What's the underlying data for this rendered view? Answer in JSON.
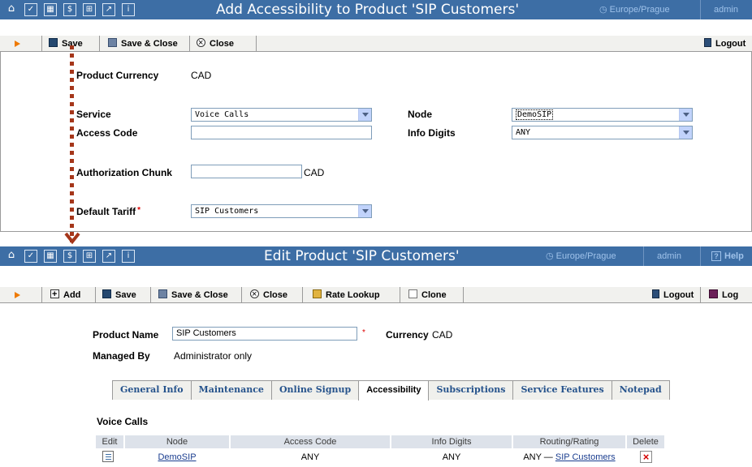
{
  "top_window": {
    "nav_icons": [
      "home-icon",
      "checklist-icon",
      "grid-icon",
      "dollar-icon",
      "tree-icon",
      "chart-icon",
      "info-icon"
    ],
    "title": "Add Accessibility to Product 'SIP Customers'",
    "timezone": "Europe/Prague",
    "user": "admin",
    "toolbar": {
      "save": "Save",
      "save_close": "Save & Close",
      "close": "Close",
      "logout": "Logout"
    },
    "form": {
      "product_currency_label": "Product Currency",
      "product_currency_value": "CAD",
      "service_label": "Service",
      "service_value": "Voice Calls",
      "node_label": "Node",
      "node_value": "DemoSIP",
      "access_code_label": "Access Code",
      "access_code_value": "",
      "info_digits_label": "Info Digits",
      "info_digits_value": "ANY",
      "auth_chunk_label": "Authorization Chunk",
      "auth_chunk_value": "",
      "auth_chunk_currency": "CAD",
      "default_tariff_label": "Default Tariff",
      "required_mark": "*",
      "default_tariff_value": "SIP Customers"
    }
  },
  "bottom_window": {
    "title": "Edit Product 'SIP Customers'",
    "timezone": "Europe/Prague",
    "user": "admin",
    "help_icon_glyph": "?",
    "help": "Help",
    "toolbar": {
      "add": "Add",
      "save": "Save",
      "save_close": "Save & Close",
      "close": "Close",
      "rate_lookup": "Rate Lookup",
      "clone": "Clone",
      "logout": "Logout",
      "log": "Log"
    },
    "form": {
      "product_name_label": "Product Name",
      "product_name_value": "SIP Customers",
      "required_mark": "*",
      "currency_label": "Currency",
      "currency_value": "CAD",
      "managed_by_label": "Managed By",
      "managed_by_value": "Administrator only"
    },
    "tabs": [
      "General Info",
      "Maintenance",
      "Online Signup",
      "Accessibility",
      "Subscriptions",
      "Service Features",
      "Notepad"
    ],
    "active_tab": "Accessibility",
    "section_title": "Voice Calls",
    "columns": [
      "Edit",
      "Node",
      "Access Code",
      "Info Digits",
      "Routing/Rating",
      "Delete"
    ],
    "row": {
      "node": "DemoSIP",
      "access_code": "ANY",
      "info_digits": "ANY",
      "routing_prefix": "ANY —",
      "routing_link": "SIP Customers"
    }
  },
  "colors": {
    "titlebar": "#3d6ea5",
    "toolbar": "#f1f1ee",
    "link": "#1a3d8f",
    "dotted_connector": "#a5361a"
  }
}
